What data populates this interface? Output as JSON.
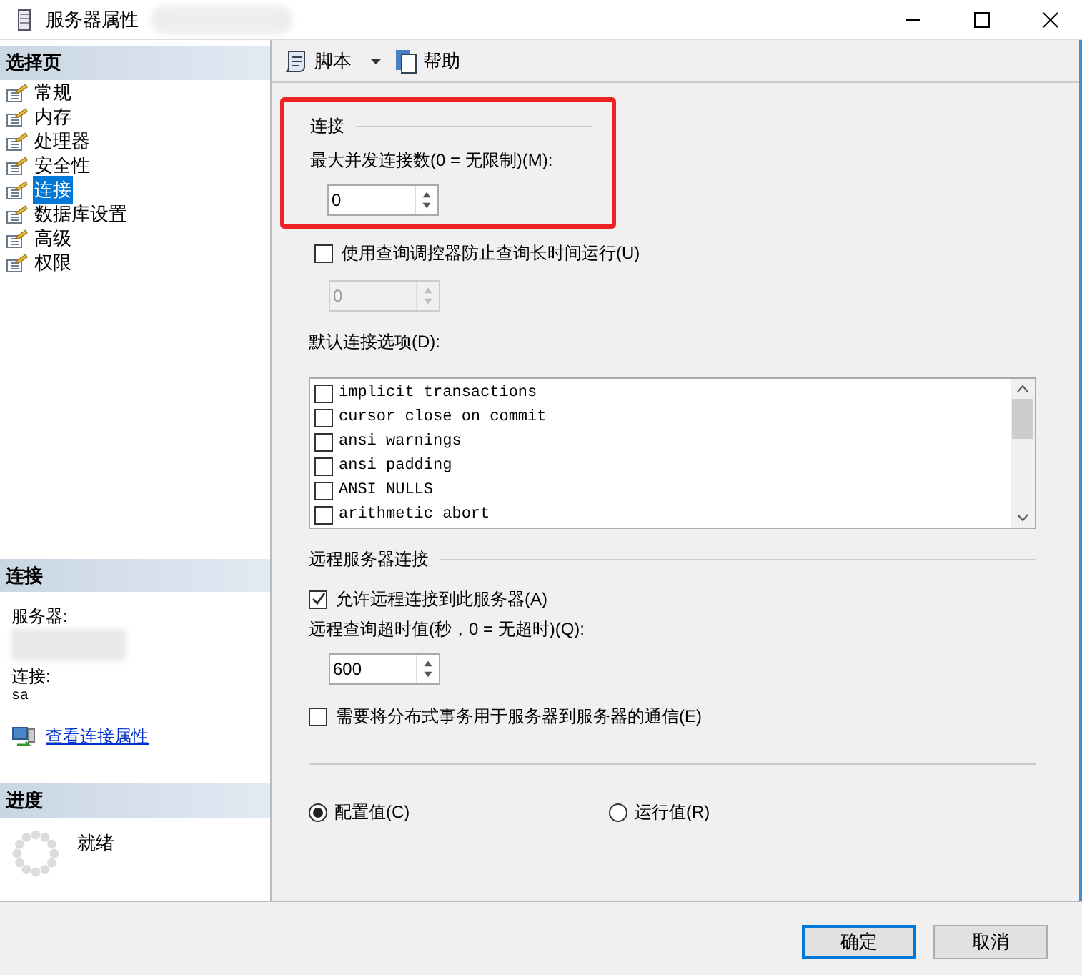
{
  "window": {
    "title": "服务器属性"
  },
  "sidebar": {
    "header": "选择页",
    "items": [
      {
        "label": "常规",
        "selected": false
      },
      {
        "label": "内存",
        "selected": false
      },
      {
        "label": "处理器",
        "selected": false
      },
      {
        "label": "安全性",
        "selected": false
      },
      {
        "label": "连接",
        "selected": true
      },
      {
        "label": "数据库设置",
        "selected": false
      },
      {
        "label": "高级",
        "selected": false
      },
      {
        "label": "权限",
        "selected": false
      }
    ],
    "connection": {
      "header": "连接",
      "server_label": "服务器:",
      "connection_label": "连接:",
      "connection_value": "sa",
      "link": "查看连接属性"
    },
    "progress": {
      "header": "进度",
      "status": "就绪"
    }
  },
  "toolbar": {
    "script": "脚本",
    "help": "帮助"
  },
  "connections": {
    "group": "连接",
    "highlighted": true,
    "max_label": "最大并发连接数(0 = 无限制)(M):",
    "max_value": "0"
  },
  "governor": {
    "label": "使用查询调控器防止查询长时间运行(U)",
    "checked": false,
    "value": "0",
    "disabled": true
  },
  "default_options": {
    "label": "默认连接选项(D):",
    "options": [
      {
        "label": "implicit transactions",
        "checked": false
      },
      {
        "label": "cursor close on commit",
        "checked": false
      },
      {
        "label": "ansi warnings",
        "checked": false
      },
      {
        "label": "ansi padding",
        "checked": false
      },
      {
        "label": "ANSI NULLS",
        "checked": false
      },
      {
        "label": "arithmetic abort",
        "checked": false
      }
    ]
  },
  "remote": {
    "group": "远程服务器连接",
    "allow_label": "允许远程连接到此服务器(A)",
    "allow_checked": true,
    "timeout_label": "远程查询超时值(秒，0 = 无超时)(Q):",
    "timeout_value": "600",
    "distributed_label": "需要将分布式事务用于服务器到服务器的通信(E)",
    "distributed_checked": false
  },
  "radios": [
    {
      "label": "配置值(C)",
      "selected": true
    },
    {
      "label": "运行值(R)",
      "selected": false
    }
  ],
  "buttons": [
    {
      "label": "确定",
      "default": true
    },
    {
      "label": "取消",
      "default": false
    }
  ]
}
